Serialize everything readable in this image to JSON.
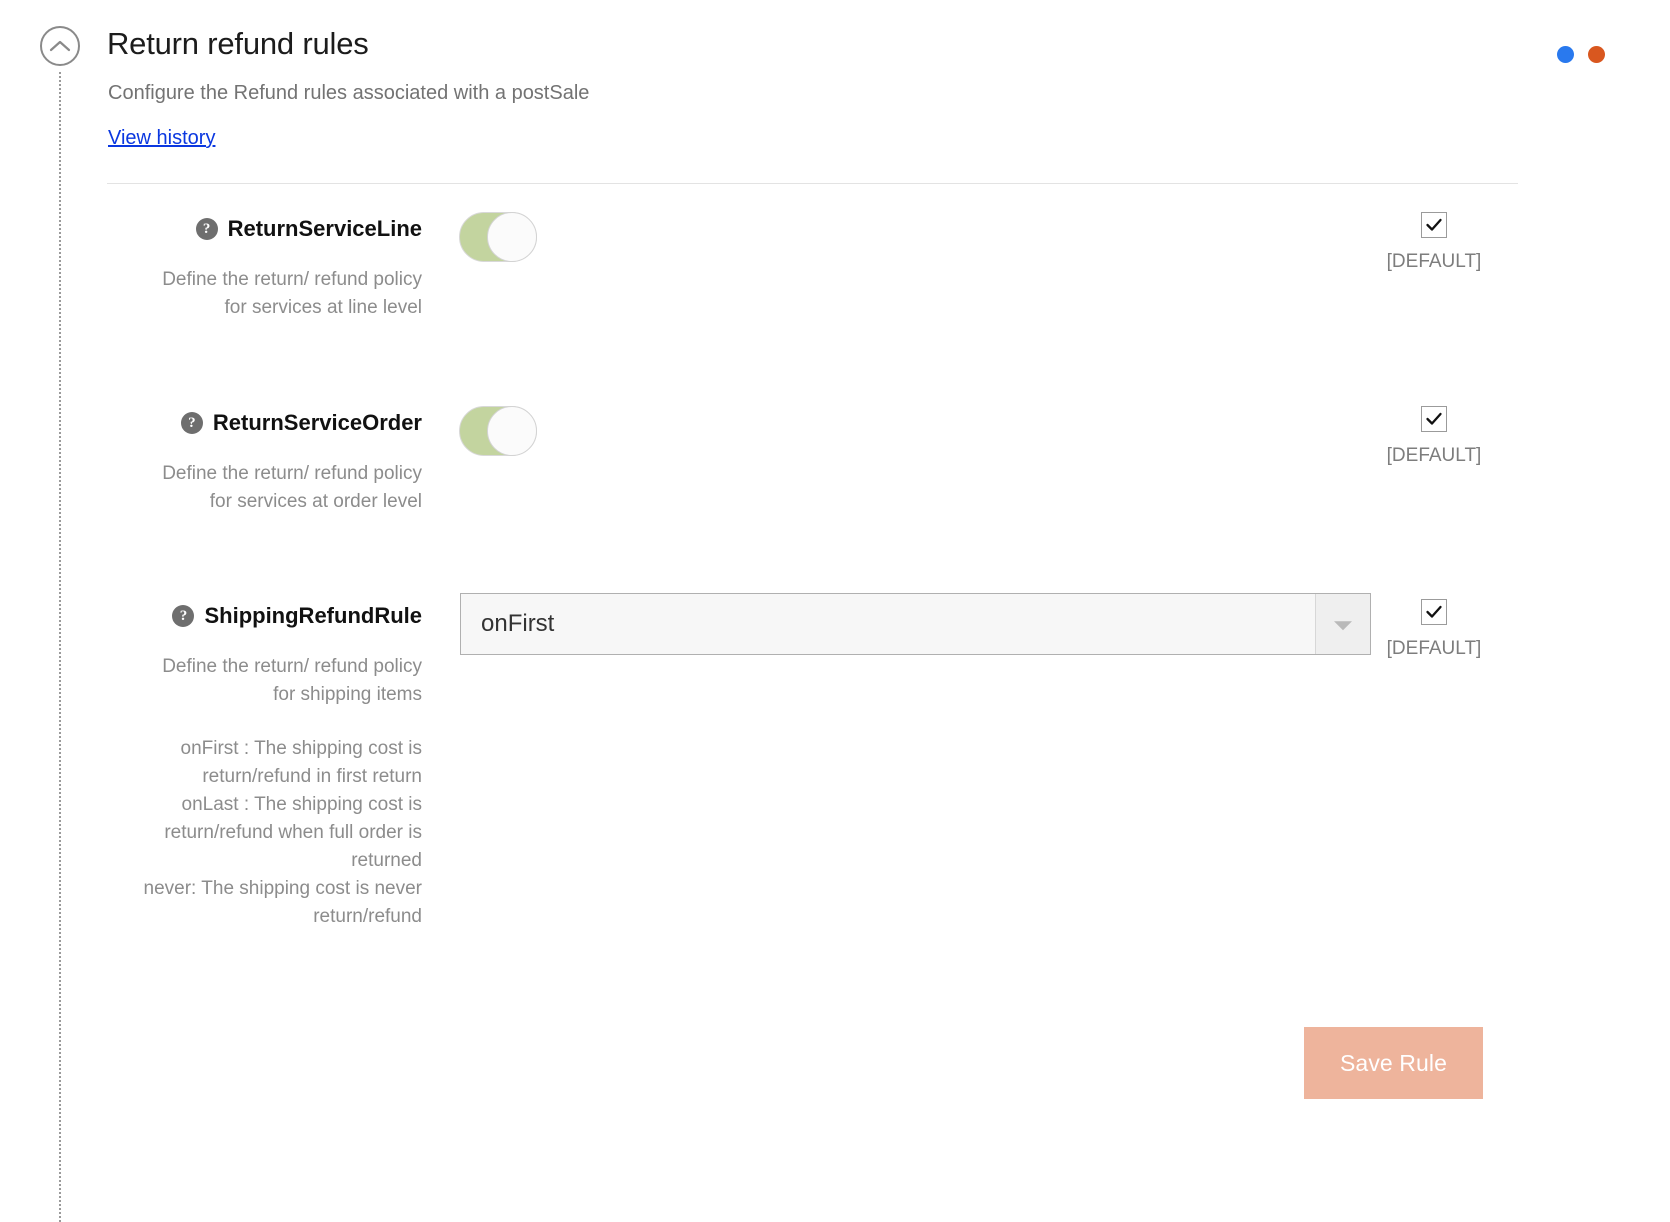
{
  "header": {
    "title": "Return refund rules",
    "subtitle": "Configure the Refund rules associated with a postSale",
    "history_link": "View history",
    "collapse_icon": "chevron-up-icon"
  },
  "window_dots": [
    {
      "name": "blue-dot",
      "color": "#2979ee"
    },
    {
      "name": "orange-dot",
      "color": "#d9571f"
    }
  ],
  "rules": [
    {
      "label": "ReturnServiceLine",
      "help_icon": "question-mark-icon",
      "description": "Define the return/ refund policy for services at line level",
      "control": "toggle",
      "toggle_state": "on",
      "toggle_track_color": "#c3d49f",
      "default_checked": true,
      "default_label": "[DEFAULT]"
    },
    {
      "label": "ReturnServiceOrder",
      "help_icon": "question-mark-icon",
      "description": "Define the return/ refund policy for services at order level",
      "control": "toggle",
      "toggle_state": "on",
      "toggle_track_color": "#c3d49f",
      "default_checked": true,
      "default_label": "[DEFAULT]"
    },
    {
      "label": "ShippingRefundRule",
      "help_icon": "question-mark-icon",
      "description": "Define the return/ refund policy for shipping items",
      "description_extra": "onFirst : The shipping cost is return/refund in first return\nonLast : The shipping cost is return/refund when full order is returned\nnever: The shipping cost is never return/refund",
      "control": "select",
      "select_value": "onFirst",
      "select_options": [
        "onFirst",
        "onLast",
        "never"
      ],
      "default_checked": true,
      "default_label": "[DEFAULT]"
    }
  ],
  "footer": {
    "save_label": "Save Rule",
    "save_color": "#eeb49c"
  }
}
